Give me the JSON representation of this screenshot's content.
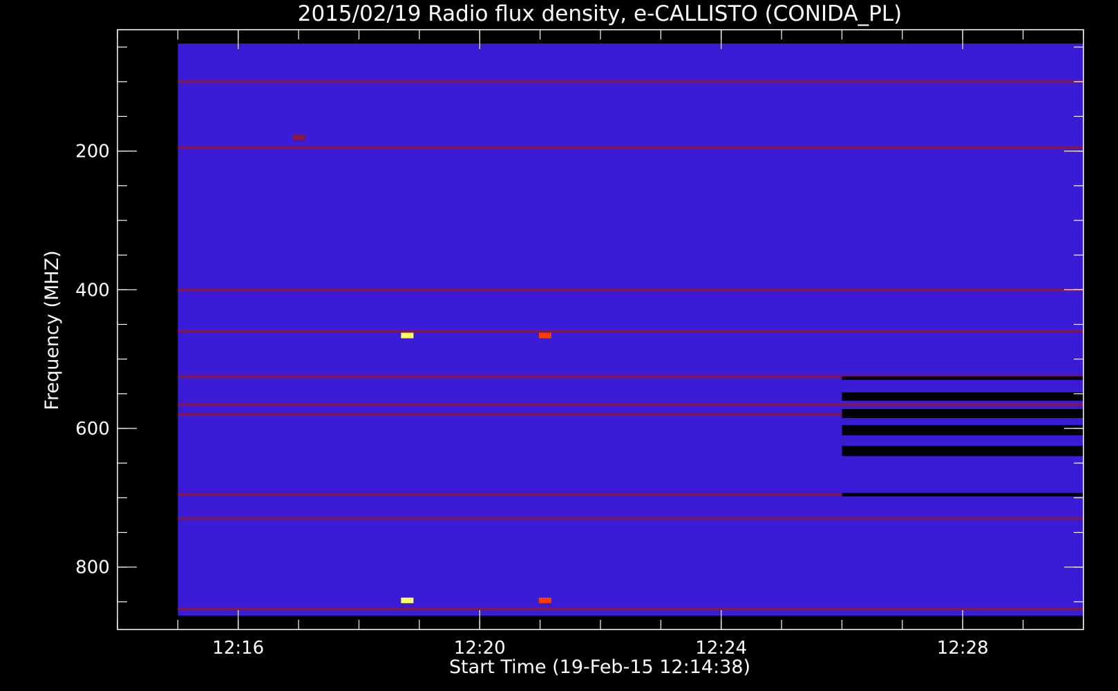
{
  "chart_data": {
    "type": "heatmap",
    "title": "2015/02/19  Radio flux density, e-CALLISTO (CONIDA_PL)",
    "xlabel": "Start Time (19-Feb-15 12:14:38)",
    "ylabel": "Frequency (MHZ)",
    "x_ticks": [
      "12:16",
      "12:20",
      "12:24",
      "12:28"
    ],
    "y_ticks": [
      "200",
      "400",
      "600",
      "800"
    ],
    "xlim": [
      "12:14",
      "12:30"
    ],
    "data_time_range": [
      "12:15:00",
      "12:30:00"
    ],
    "ylim": [
      25,
      890
    ],
    "y_axis_inverted": true,
    "frequency_range_mhz": [
      45,
      870
    ],
    "colors": {
      "background": "#000000",
      "axes": "#ffffff",
      "baseline": "#3a1bd6",
      "enhanced": "#8a1840",
      "burst": "#ff3b00",
      "peak": "#ffff60",
      "dropout": "#000000"
    },
    "rfi_bands_mhz": [
      100,
      195,
      460,
      525,
      565,
      580,
      400,
      695,
      730,
      860
    ],
    "dropout_after": "12:26",
    "dropout_bands_mhz": [
      [
        525,
        530
      ],
      [
        548,
        560
      ],
      [
        572,
        585
      ],
      [
        595,
        610
      ],
      [
        625,
        640
      ],
      [
        693,
        698
      ]
    ],
    "bursts": [
      {
        "time": "12:17:00",
        "freq_mhz": 180,
        "level": "enhanced"
      },
      {
        "time": "12:18:48",
        "freq_mhz": 466,
        "level": "peak"
      },
      {
        "time": "12:18:48",
        "freq_mhz": 848,
        "level": "peak"
      },
      {
        "time": "12:21:05",
        "freq_mhz": 466,
        "level": "burst"
      },
      {
        "time": "12:21:05",
        "freq_mhz": 848,
        "level": "burst"
      }
    ]
  }
}
